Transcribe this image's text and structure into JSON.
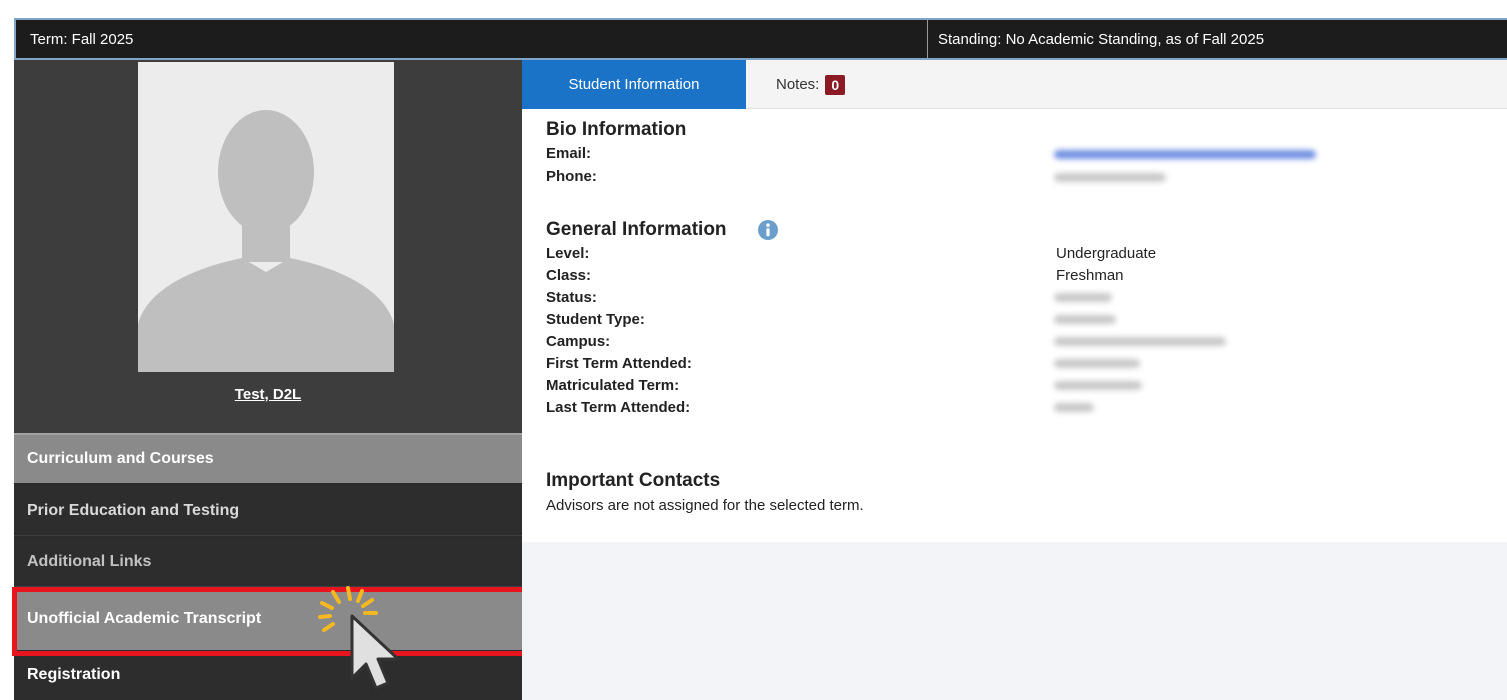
{
  "header": {
    "term_label": "Term:",
    "term_value": "Fall 2025",
    "standing_label": "Standing:",
    "standing_value": "No Academic Standing, as of Fall 2025"
  },
  "profile": {
    "name": "Test, D2L"
  },
  "nav": {
    "items": [
      {
        "label": "Curriculum and Courses"
      },
      {
        "label": "Prior Education and Testing"
      },
      {
        "label": "Additional Links"
      },
      {
        "label": "Unofficial Academic Transcript"
      },
      {
        "label": "Registration"
      }
    ]
  },
  "tabs": {
    "student_info": "Student Information",
    "notes_label": "Notes:",
    "notes_count": "0"
  },
  "bio": {
    "title": "Bio Information",
    "email_label": "Email:",
    "phone_label": "Phone:"
  },
  "general": {
    "title": "General Information",
    "level_label": "Level:",
    "level_value": "Undergraduate",
    "class_label": "Class:",
    "class_value": "Freshman",
    "status_label": "Status:",
    "student_type_label": "Student Type:",
    "campus_label": "Campus:",
    "first_term_label": "First Term Attended:",
    "matriculated_label": "Matriculated Term:",
    "last_term_label": "Last Term Attended:"
  },
  "contacts": {
    "title": "Important Contacts",
    "message": "Advisors are not assigned for the selected term."
  },
  "colors": {
    "active_tab": "#1a73c7",
    "badge": "#8c1a24",
    "highlight": "#e8141e",
    "sidebar_dark": "#2b2b2b",
    "sidebar_selected": "#8a8a8a"
  }
}
